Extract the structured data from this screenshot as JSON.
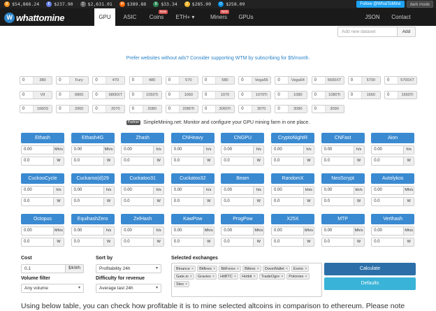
{
  "ticker": [
    {
      "symbol": "B",
      "color": "#f7931a",
      "value": "$54,866.24"
    },
    {
      "symbol": "E",
      "color": "#627eea",
      "value": "$237.90"
    },
    {
      "symbol": "Ξ",
      "color": "#6c6c6c",
      "value": "$2,631.01"
    },
    {
      "symbol": "M",
      "color": "#ff6600",
      "value": "$389.88"
    },
    {
      "symbol": "R",
      "color": "#2e8b57",
      "value": "$33.34"
    },
    {
      "symbol": "Z",
      "color": "#f4b728",
      "value": "$285.09"
    },
    {
      "symbol": "D",
      "color": "#008de4",
      "value": "$258.09"
    }
  ],
  "ticker_buttons": {
    "twitter": "Follow @WhatToMine",
    "dark": "dark mode"
  },
  "logo": {
    "part1": "what",
    "part2": "to",
    "part3": "mine"
  },
  "nav": {
    "gpu": "GPU",
    "asic": "ASIC",
    "coins": "Coins",
    "eth": "ETH+ ▾",
    "miners": "Miners",
    "gpus": "GPUs",
    "json": "JSON",
    "contact": "Contact",
    "new_badge": "New"
  },
  "dataset": {
    "placeholder": "Add new dataset",
    "add": "Add"
  },
  "promo": "Prefer websites without ads? Consider supporting WTM by subscribing for $5/month.",
  "gpus": [
    [
      "0",
      "380"
    ],
    [
      "0",
      "Fury"
    ],
    [
      "0",
      "470"
    ],
    [
      "0",
      "480"
    ],
    [
      "0",
      "570"
    ],
    [
      "0",
      "580"
    ],
    [
      "0",
      "Vega56"
    ],
    [
      "0",
      "Vega64"
    ],
    [
      "0",
      "5600XT"
    ],
    [
      "0",
      "5700"
    ],
    [
      "0",
      "5700XT"
    ],
    [
      "0",
      "VII"
    ],
    [
      "0",
      "6800"
    ],
    [
      "0",
      "6800XT"
    ],
    [
      "0",
      "1050Ti"
    ],
    [
      "0",
      "1060"
    ],
    [
      "0",
      "1070"
    ],
    [
      "0",
      "1070Ti"
    ],
    [
      "0",
      "1080"
    ],
    [
      "0",
      "1080Ti"
    ],
    [
      "0",
      "1660"
    ],
    [
      "0",
      "1660Ti"
    ],
    [
      "0",
      "1660S"
    ],
    [
      "0",
      "2060"
    ],
    [
      "0",
      "2070"
    ],
    [
      "0",
      "2080"
    ],
    [
      "0",
      "2080Ti"
    ],
    [
      "0",
      "3060Ti"
    ],
    [
      "0",
      "3070"
    ],
    [
      "0",
      "3080"
    ],
    [
      "0",
      "3090"
    ]
  ],
  "partner": {
    "tag": "Partner",
    "text": "SimpleMining.net: Monitor and configure your GPU mining farm in one place."
  },
  "algorithms": [
    {
      "name": "Ethash",
      "hash": "0.00",
      "hash_unit": "Mh/s",
      "power": "0.0",
      "power_unit": "W"
    },
    {
      "name": "Ethash4G",
      "hash": "0.00",
      "hash_unit": "Mh/s",
      "power": "0.0",
      "power_unit": "W"
    },
    {
      "name": "Zhash",
      "hash": "0.00",
      "hash_unit": "h/s",
      "power": "0.0",
      "power_unit": "W"
    },
    {
      "name": "CNHeavy",
      "hash": "0.00",
      "hash_unit": "h/s",
      "power": "0.0",
      "power_unit": "W"
    },
    {
      "name": "CNGPU",
      "hash": "0.00",
      "hash_unit": "h/s",
      "power": "0.0",
      "power_unit": "W"
    },
    {
      "name": "CryptoNightR",
      "hash": "0.00",
      "hash_unit": "h/s",
      "power": "0.0",
      "power_unit": "W"
    },
    {
      "name": "CNFast",
      "hash": "0.00",
      "hash_unit": "h/s",
      "power": "0.0",
      "power_unit": "W"
    },
    {
      "name": "Aion",
      "hash": "0.00",
      "hash_unit": "h/s",
      "power": "0.0",
      "power_unit": "W"
    },
    {
      "name": "CuckooCycle",
      "hash": "0.00",
      "hash_unit": "h/s",
      "power": "0.0",
      "power_unit": "W"
    },
    {
      "name": "Cuckaroo(d)29",
      "hash": "0.00",
      "hash_unit": "h/s",
      "power": "0.0",
      "power_unit": "W"
    },
    {
      "name": "Cuckatoo31",
      "hash": "0.00",
      "hash_unit": "h/s",
      "power": "0.0",
      "power_unit": "W"
    },
    {
      "name": "Cuckatoo32",
      "hash": "0.00",
      "hash_unit": "h/s",
      "power": "0.0",
      "power_unit": "W"
    },
    {
      "name": "Beam",
      "hash": "0.00",
      "hash_unit": "h/s",
      "power": "0.0",
      "power_unit": "W"
    },
    {
      "name": "RandomX",
      "hash": "0.00",
      "hash_unit": "kh/s",
      "power": "0.0",
      "power_unit": "W"
    },
    {
      "name": "NeoScrypt",
      "hash": "0.00",
      "hash_unit": "kh/s",
      "power": "0.0",
      "power_unit": "W"
    },
    {
      "name": "Autolykos",
      "hash": "0.00",
      "hash_unit": "Mh/s",
      "power": "0.0",
      "power_unit": "W"
    },
    {
      "name": "Octopus",
      "hash": "0.00",
      "hash_unit": "Mh/s",
      "power": "0.0",
      "power_unit": "W"
    },
    {
      "name": "EquihashZero",
      "hash": "0.00",
      "hash_unit": "h/s",
      "power": "0.0",
      "power_unit": "W"
    },
    {
      "name": "ZelHash",
      "hash": "0.00",
      "hash_unit": "h/s",
      "power": "0.0",
      "power_unit": "W"
    },
    {
      "name": "KawPow",
      "hash": "0.00",
      "hash_unit": "Mh/s",
      "power": "0.0",
      "power_unit": "W"
    },
    {
      "name": "ProgPow",
      "hash": "0.00",
      "hash_unit": "Mh/s",
      "power": "0.0",
      "power_unit": "W"
    },
    {
      "name": "X25X",
      "hash": "0.00",
      "hash_unit": "Mh/s",
      "power": "0.0",
      "power_unit": "W"
    },
    {
      "name": "MTP",
      "hash": "0.00",
      "hash_unit": "Mh/s",
      "power": "0.0",
      "power_unit": "W"
    },
    {
      "name": "Verthash",
      "hash": "0.00",
      "hash_unit": "Mh/s",
      "power": "0.0",
      "power_unit": "W"
    }
  ],
  "cost": {
    "label": "Cost",
    "value": "0.1",
    "unit": "$/kWh"
  },
  "volume": {
    "label": "Volume filter",
    "value": "Any volume"
  },
  "sort": {
    "label": "Sort by",
    "value": "Profitability 24h"
  },
  "difficulty": {
    "label": "Difficulty for revenue",
    "value": "Average last 24h"
  },
  "exchanges": {
    "label": "Selected exchanges",
    "items": [
      "Binance",
      "Bitfinex",
      "BitForex",
      "Bittrex",
      "DoveWallet",
      "Exmo",
      "Gate.io",
      "Graviex",
      "HitBTC",
      "Hotbit",
      "TradeOgre",
      "Poloniex",
      "Stex"
    ]
  },
  "buttons": {
    "calculate": "Calculate",
    "defaults": "Defaults"
  },
  "description": "Using below table, you can check how profitable it is to mine selected altcoins in comparison to ethereum. Please note"
}
